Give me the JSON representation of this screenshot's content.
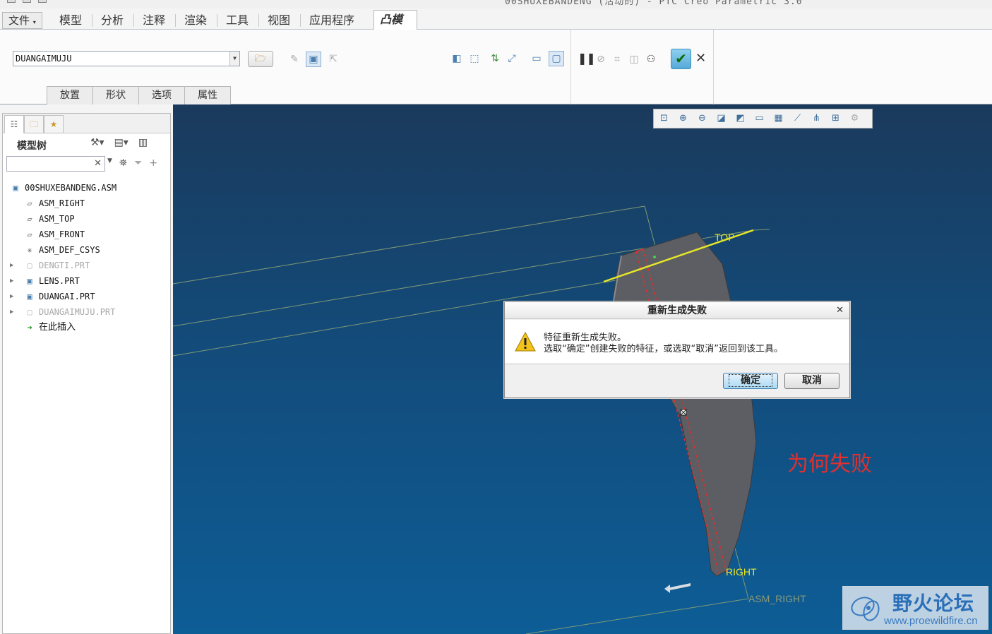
{
  "title_strip": {
    "title": "00SHUXEBANDENG (活动的) - PTC Creo Parametric 3.0"
  },
  "menu": {
    "file": "文件",
    "items": [
      "模型",
      "分析",
      "注释",
      "渲染",
      "工具",
      "视图",
      "应用程序"
    ],
    "active_tab": "凸模"
  },
  "ribbon": {
    "combo_value": "DUANGAIMUJU",
    "subtabs": [
      "放置",
      "形状",
      "选项",
      "属性"
    ]
  },
  "model_tree": {
    "heading": "模型树",
    "search_placeholder": "",
    "items": [
      {
        "label": "00SHUXEBANDENG.ASM",
        "icon": "assembly-icon",
        "dim": false,
        "expandable": false
      },
      {
        "label": "ASM_RIGHT",
        "icon": "datum-plane-icon",
        "dim": false,
        "expandable": false
      },
      {
        "label": "ASM_TOP",
        "icon": "datum-plane-icon",
        "dim": false,
        "expandable": false
      },
      {
        "label": "ASM_FRONT",
        "icon": "datum-plane-icon",
        "dim": false,
        "expandable": false
      },
      {
        "label": "ASM_DEF_CSYS",
        "icon": "csys-icon",
        "dim": false,
        "expandable": false
      },
      {
        "label": "DENGTI.PRT",
        "icon": "part-icon",
        "dim": true,
        "expandable": true
      },
      {
        "label": "LENS.PRT",
        "icon": "part-icon",
        "dim": false,
        "expandable": true
      },
      {
        "label": "DUANGAI.PRT",
        "icon": "part-icon",
        "dim": false,
        "expandable": true
      },
      {
        "label": "DUANGAIMUJU.PRT",
        "icon": "part-icon",
        "dim": true,
        "expandable": true
      },
      {
        "label": "在此插入",
        "icon": "insert-arrow-icon",
        "dim": false,
        "expandable": false
      }
    ]
  },
  "viewport": {
    "label_top": "TOP",
    "label_right": "RIGHT",
    "label_asm_right": "ASM_RIGHT",
    "annotation": "为何失败",
    "watermark_title": "野火论坛",
    "watermark_url": "www.proewildfire.cn",
    "colors": {
      "annotation": "#e03030",
      "datum_label": "#e6e628"
    }
  },
  "dialog": {
    "title": "重新生成失败",
    "line1": "特征重新生成失败。",
    "line2": "选取“确定”创建失败的特征，或选取“取消”返回到该工具。",
    "ok_label": "确定",
    "cancel_label": "取消"
  }
}
